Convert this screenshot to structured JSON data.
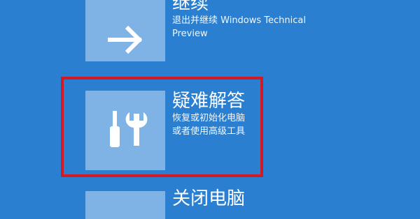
{
  "options": [
    {
      "title": "继续",
      "desc_lines": [
        "退出并继续 Windows Technical",
        "Preview"
      ],
      "icon": "arrow-right-icon"
    },
    {
      "title": "疑难解答",
      "desc_lines": [
        "恢复或初始化电脑",
        "或者使用高级工具"
      ],
      "icon": "troubleshoot-tools-icon"
    },
    {
      "title": "关闭电脑",
      "desc_lines": [],
      "icon": "power-icon"
    }
  ],
  "colors": {
    "background": "#2a7fd0",
    "tile": "#7fb2e5",
    "text": "#ffffff",
    "highlight": "#d11a25"
  }
}
